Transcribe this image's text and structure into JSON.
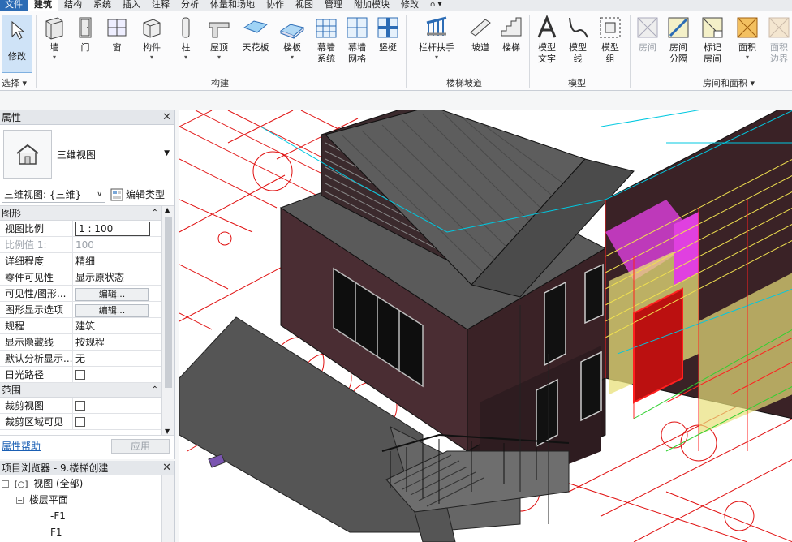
{
  "tabs": {
    "items": [
      "文件",
      "建筑",
      "结构",
      "系统",
      "插入",
      "注释",
      "分析",
      "体量和场地",
      "协作",
      "视图",
      "管理",
      "附加模块",
      "修改"
    ],
    "extra": "⌂ ▾"
  },
  "ribbon": {
    "modify": "修改",
    "select_panel": "选择",
    "build_panel": "构建",
    "stairs_panel": "楼梯坡道",
    "model_panel": "模型",
    "room_panel": "房间和面积",
    "tools": {
      "wall": "墙",
      "door": "门",
      "window": "窗",
      "component": "构件",
      "column": "柱",
      "roof": "屋顶",
      "ceiling": "天花板",
      "floor": "楼板",
      "curtain_system_1": "幕墙",
      "curtain_system_2": "系统",
      "curtain_grid_1": "幕墙",
      "curtain_grid_2": "网格",
      "mullion": "竖梃",
      "railing": "栏杆扶手",
      "ramp": "坡道",
      "stair": "楼梯",
      "model_text_1": "模型",
      "model_text_2": "文字",
      "model_line_1": "模型",
      "model_line_2": "线",
      "model_group_1": "模型",
      "model_group_2": "组",
      "room": "房间",
      "room_sep_1": "房间",
      "room_sep_2": "分隔",
      "tag_room_1": "标记",
      "tag_room_2": "房间",
      "area": "面积",
      "area_boundary_1": "面积",
      "area_boundary_2": "边界"
    }
  },
  "properties": {
    "title": "属性",
    "type_name": "三维视图",
    "view_selector": "三维视图: {三维}",
    "edit_type": "编辑类型",
    "groups": {
      "graphics": "图形",
      "extents": "范围"
    },
    "rows": {
      "view_scale_k": "视图比例",
      "view_scale_v": "1 : 100",
      "scale_value_k": "比例值 1:",
      "scale_value_v": "100",
      "detail_level_k": "详细程度",
      "detail_level_v": "精细",
      "parts_vis_k": "零件可见性",
      "parts_vis_v": "显示原状态",
      "vg_k": "可见性/图形...",
      "vg_v": "编辑...",
      "gdo_k": "图形显示选项",
      "gdo_v": "编辑...",
      "discipline_k": "规程",
      "discipline_v": "建筑",
      "hidden_lines_k": "显示隐藏线",
      "hidden_lines_v": "按规程",
      "analysis_k": "默认分析显示...",
      "analysis_v": "无",
      "sun_path_k": "日光路径",
      "crop_view_k": "裁剪视图",
      "crop_visible_k": "裁剪区域可见"
    },
    "help": "属性帮助",
    "apply": "应用"
  },
  "browser": {
    "title": "项目浏览器 - 9.楼梯创建",
    "views": "视图 (全部)",
    "floor_plans": "楼层平面",
    "items": [
      "-F1",
      "F1"
    ]
  },
  "colors": {
    "accent": "#2c6cb5",
    "wall_dark": "#4a2d33",
    "red_lines": "#e01010",
    "cyan_lines": "#00c8e0",
    "magenta": "#e040e0",
    "yellow": "#f0e050"
  }
}
